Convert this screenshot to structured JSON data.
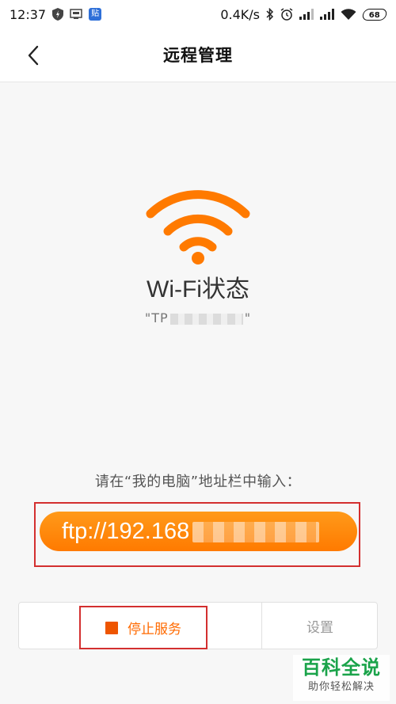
{
  "status_bar": {
    "time": "12:37",
    "speed": "0.4K/s",
    "battery": "68",
    "app_tag": "贴",
    "icons": [
      "shield-icon",
      "ftp-icon",
      "app-tag-icon",
      "bluetooth-icon",
      "alarm-icon",
      "signal-icon",
      "signal-icon",
      "wifi-icon",
      "battery-icon"
    ]
  },
  "nav": {
    "title": "远程管理",
    "back_icon": "chevron-left-icon"
  },
  "wifi": {
    "icon": "wifi-icon",
    "title": "Wi-Fi状态",
    "ssid_prefix": "\"TP",
    "ssid_suffix": "\""
  },
  "hint": "请在“我的电脑”地址栏中输入：",
  "ftp": {
    "address_prefix": "ftp://192.168"
  },
  "actions": {
    "stop_label": "停止服务",
    "settings_label": "设置"
  },
  "watermark": {
    "main": "百科全说",
    "sub": "助你轻松解决"
  },
  "colors": {
    "accent": "#ff7a00",
    "highlight": "#d32f2f",
    "watermark": "#1aa34a"
  }
}
